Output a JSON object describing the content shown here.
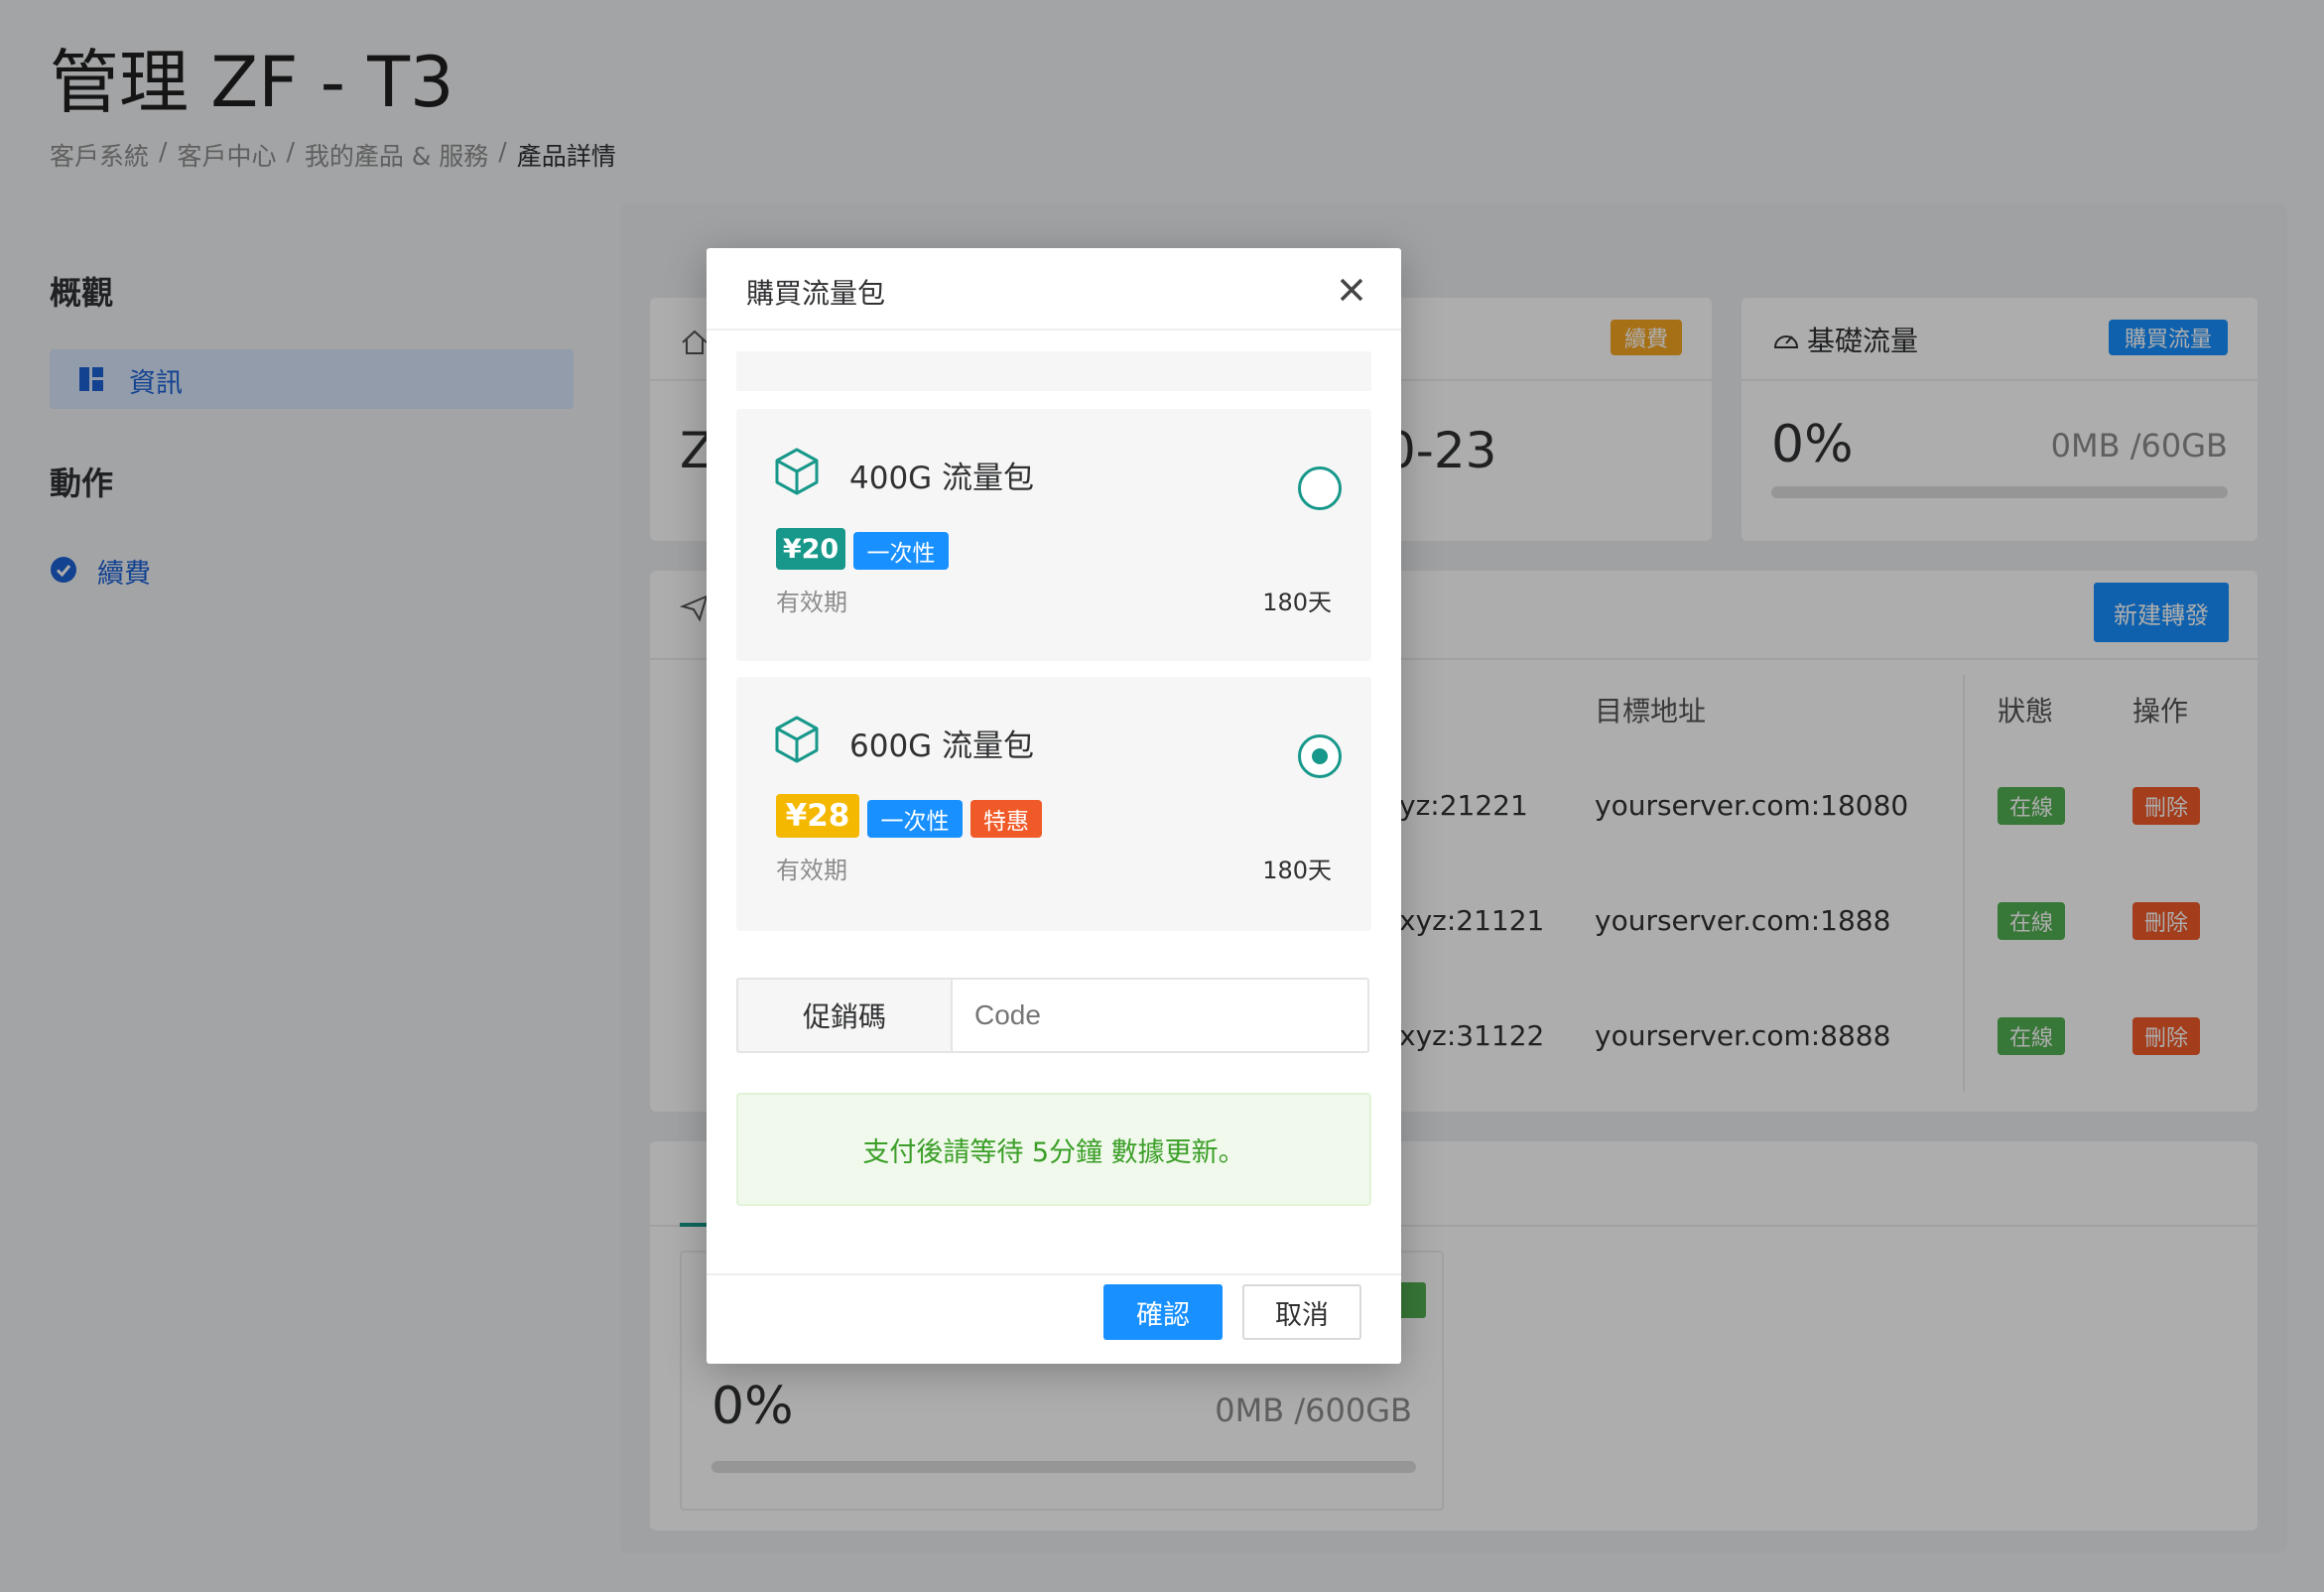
{
  "page": {
    "title": "管理 ZF - T3",
    "breadcrumb": [
      "客戶系統",
      "客戶中心",
      "我的產品 & 服務",
      "產品詳情"
    ]
  },
  "sidebar": {
    "section_overview": "概觀",
    "item_info": "資訊",
    "section_actions": "動作",
    "item_renew": "續費"
  },
  "cards": {
    "info": {
      "value_fragment": "Z"
    },
    "expiry": {
      "tag": "續費",
      "value_fragment": "0-23"
    },
    "base_traffic": {
      "title": "基礎流量",
      "tag": "購買流量",
      "percent": "0%",
      "usage": "0MB /60GB",
      "progress": 0
    }
  },
  "forwarding": {
    "new_button": "新建轉發",
    "headers": {
      "target": "目標地址",
      "status": "狀態",
      "action": "操作"
    },
    "rows": [
      {
        "source_fragment": "yz:21221",
        "target": "yourserver.com:18080",
        "status": "在線",
        "action": "刪除"
      },
      {
        "source_fragment": "xyz:21121",
        "target": "yourserver.com:1888",
        "status": "在線",
        "action": "刪除"
      },
      {
        "source_fragment": "xyz:31122",
        "target": "yourserver.com:8888",
        "status": "在線",
        "action": "刪除"
      }
    ]
  },
  "traffic_pack_card": {
    "percent": "0%",
    "usage": "0MB /600GB",
    "progress": 0
  },
  "modal": {
    "title": "購買流量包",
    "packages": [
      {
        "name": "400G 流量包",
        "price": "¥20",
        "tags": [
          "一次性"
        ],
        "validity_label": "有效期",
        "validity": "180天",
        "selected": false
      },
      {
        "name": "600G 流量包",
        "price": "¥28",
        "tags": [
          "一次性",
          "特惠"
        ],
        "validity_label": "有效期",
        "validity": "180天",
        "selected": true
      }
    ],
    "promo_label": "促銷碼",
    "promo_placeholder": "Code",
    "notice": "支付後請等待 5分鐘 數據更新。",
    "confirm": "確認",
    "cancel": "取消"
  },
  "colors": {
    "primary": "#1890ff",
    "teal": "#17988a",
    "orange": "#f5a623",
    "red": "#f05a28",
    "green_tag": "#52b052",
    "notice_bg": "#f0f9eb",
    "notice_text": "#3a9e27"
  }
}
